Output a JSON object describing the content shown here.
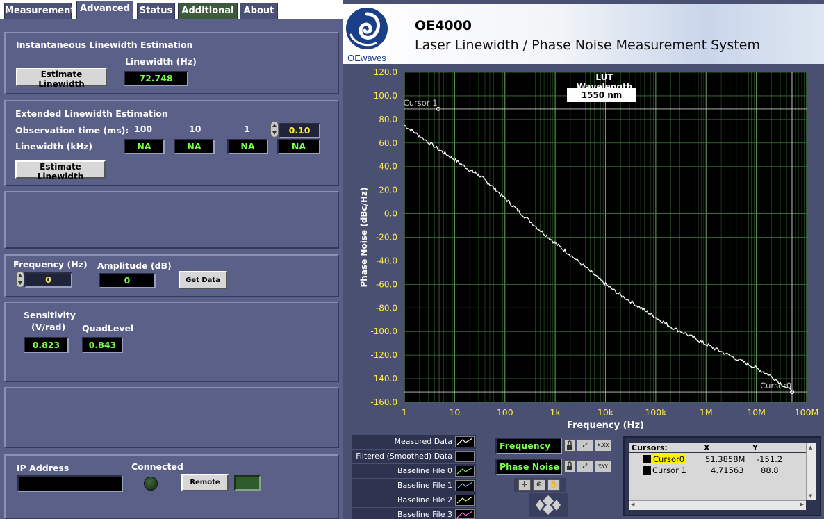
{
  "tabs": [
    {
      "label": "Measurement",
      "active": false
    },
    {
      "label": "Advanced",
      "active": true
    },
    {
      "label": "Status",
      "active": false
    },
    {
      "label": "Additional",
      "active": false
    },
    {
      "label": "About",
      "active": false
    }
  ],
  "instant": {
    "title": "Instantaneous Linewidth Estimation",
    "button": "Estimate Linewidth",
    "linewidth_label": "Linewidth (Hz)",
    "linewidth_value": "72.748"
  },
  "extended": {
    "title": "Extended Linewidth Estimation",
    "obs_label": "Observation time (ms):",
    "lw_label": "Linewidth (kHz)",
    "obs_times": [
      "100",
      "10",
      "1",
      "0.10"
    ],
    "linewidths": [
      "NA",
      "NA",
      "NA",
      "NA"
    ],
    "button": "Estimate Linewidth"
  },
  "getdata": {
    "freq_label": "Frequency (Hz)",
    "freq_value": "0",
    "amp_label": "Amplitude (dB)",
    "amp_value": "0",
    "button": "Get Data"
  },
  "sensitivity": {
    "sens_label_1": "Sensitivity",
    "sens_label_2": "(V/rad)",
    "sens_value": "0.823",
    "quad_label": "QuadLevel",
    "quad_value": "0.843"
  },
  "network": {
    "ip_label": "IP Address",
    "ip_value": "",
    "connected_label": "Connected",
    "remote_button": "Remote"
  },
  "header": {
    "logo_text": "OEwaves",
    "product": "OE4000",
    "subtitle": "Laser Linewidth / Phase Noise Measurement System"
  },
  "chart_data": {
    "type": "line",
    "xscale": "log",
    "xlabel": "Frequency (Hz)",
    "ylabel": "Phase Noise (dBc/Hz)",
    "xlim": [
      1,
      100000000
    ],
    "ylim": [
      -160,
      120
    ],
    "x_ticks": [
      "1",
      "10",
      "100",
      "1k",
      "10k",
      "100k",
      "1M",
      "10M",
      "100M"
    ],
    "y_ticks": [
      "120.0",
      "100.0",
      "80.0",
      "60.0",
      "40.0",
      "20.0",
      "0.0",
      "-20.0",
      "-40.0",
      "-60.0",
      "-80.0",
      "-100.0",
      "-120.0",
      "-140.0",
      "-160.0"
    ],
    "grid": true,
    "overlay_label": "LUT Wavelength",
    "overlay_value": "1550 nm",
    "series": [
      {
        "x": [
          1,
          2,
          5,
          10,
          20,
          30,
          50,
          100,
          200,
          500,
          1000,
          2000,
          5000,
          10000,
          20000,
          50000,
          100000,
          200000,
          500000,
          1000000,
          2000000,
          5000000,
          10000000,
          20000000,
          51385800
        ],
        "y": [
          75,
          66,
          54,
          46,
          37,
          33,
          25,
          13,
          1,
          -14,
          -25,
          -35,
          -49,
          -60,
          -69,
          -80,
          -88,
          -96,
          -104,
          -111,
          -117,
          -125,
          -131,
          -138,
          -151
        ]
      }
    ],
    "cursors": [
      {
        "label": "Cursor 1",
        "x": 4.71563,
        "y": 88.8
      },
      {
        "label": "Cursor0",
        "x": 51385800,
        "y": -151.2
      }
    ]
  },
  "legend": [
    "Measured Data",
    "Filtered (Smoothed) Data",
    "Baseline File 0",
    "Baseline File 1",
    "Baseline File 2",
    "Baseline File 3"
  ],
  "axis_controls": {
    "x_name": "Frequency",
    "y_name": "Phase Noise",
    "x_format": "X.XX",
    "y_format": "Y.YY"
  },
  "cursor_table": {
    "headers": [
      "Cursors:",
      "X",
      "Y"
    ],
    "rows": [
      {
        "name": "Cursor0",
        "x": "51.3858M",
        "y": "-151.2"
      },
      {
        "name": "Cursor 1",
        "x": "4.71563",
        "y": "88.8"
      }
    ]
  },
  "colors": {
    "panel": "#5b6088",
    "plot_bg": "#000000",
    "grid": "#3d7a3a",
    "trace": "#ffffff",
    "tick_text": "#ffe94a",
    "display_text": "#7cff4a"
  }
}
